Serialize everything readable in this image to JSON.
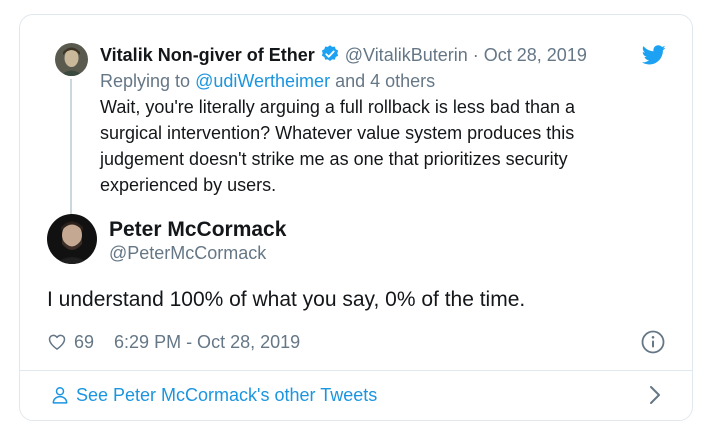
{
  "parent_tweet": {
    "display_name": "Vitalik Non-giver of Ether",
    "handle": "@VitalikButerin",
    "separator": "·",
    "date": "Oct 28, 2019",
    "replying_prefix": "Replying to",
    "replying_handle": "@udiWertheimer",
    "replying_suffix": "and 4 others",
    "text": "Wait, you're literally arguing a full rollback is less bad than a surgical intervention? Whatever value system produces this judgement doesn't strike me as one that prioritizes security experienced by users.",
    "verified": true
  },
  "tweet": {
    "display_name": "Peter McCormack",
    "handle": "@PeterMcCormack",
    "text": "I understand 100% of what you say, 0% of the time.",
    "like_count": "69",
    "timestamp": "6:29 PM - Oct 28, 2019"
  },
  "footer": {
    "link_text": "See Peter McCormack's other Tweets"
  },
  "colors": {
    "brand_blue": "#1da1f2",
    "link_blue": "#1b95e0",
    "muted_text": "#657786",
    "primary_text": "#14171a",
    "border": "#e1e8ed"
  },
  "icons": {
    "brand": "twitter-bird-icon",
    "verified": "verified-badge-icon",
    "like": "heart-icon",
    "info": "info-icon",
    "footer": "person-icon",
    "footer_arrow": "chevron-right-icon"
  }
}
